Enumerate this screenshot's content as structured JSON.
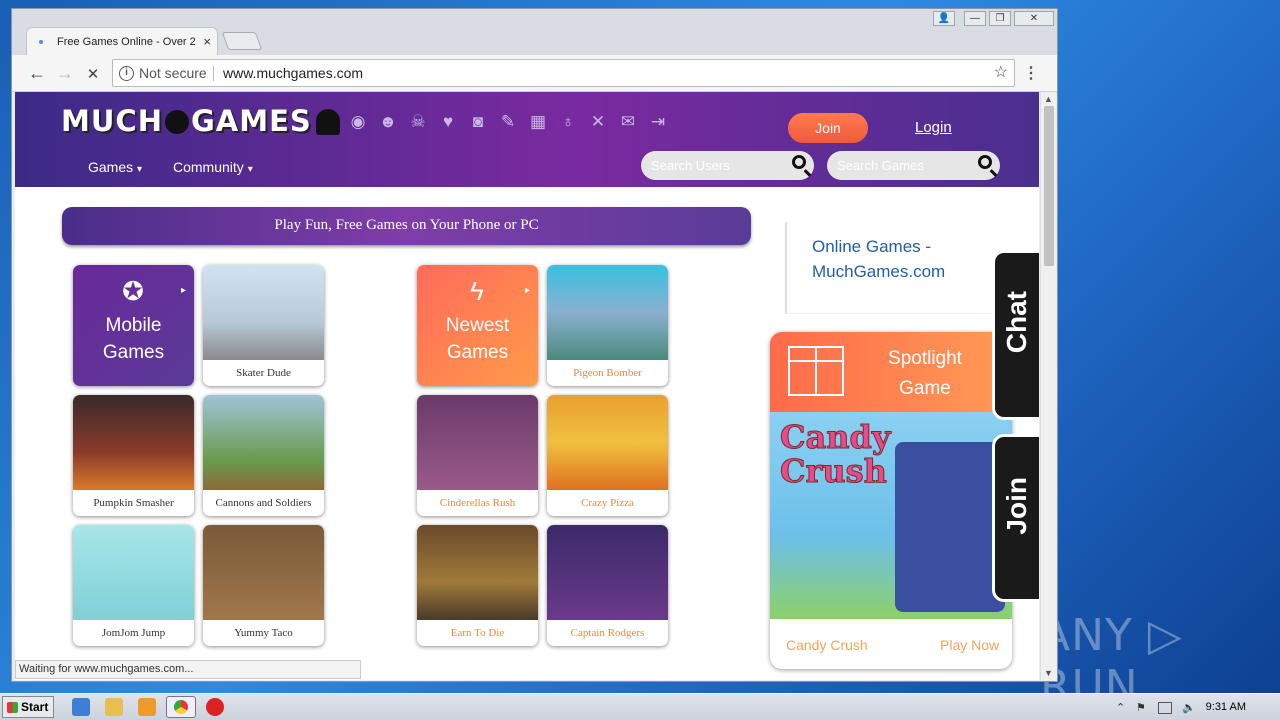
{
  "browser": {
    "tab_title": "Free Games Online - Over 2",
    "tab_close": "×",
    "not_secure": "Not secure",
    "url": "www.muchgames.com",
    "info": "i",
    "back": "←",
    "forward": "→",
    "stop": "✕",
    "star": "☆",
    "menu": "⋮",
    "window_controls": {
      "user": "👤",
      "minimize": "—",
      "restore": "❐",
      "close": "✕"
    }
  },
  "site": {
    "logo": {
      "part1": "MUCH",
      "part2": "GAMES"
    },
    "header_icons": [
      "rss-icon",
      "skull-icon",
      "skulls-icon",
      "heart-icon",
      "camera-icon",
      "pencil-icon",
      "gift-icon",
      "medal-icon",
      "tools-icon",
      "mail-icon",
      "logout-icon"
    ],
    "header_glyphs": [
      "◉",
      "☻",
      "☠",
      "♥",
      "◙",
      "✎",
      "▦",
      "♁",
      "✕",
      "✉",
      "⇥"
    ],
    "join": "Join",
    "login": "Login",
    "nav": {
      "games": "Games",
      "community": "Community",
      "caret": "▾"
    },
    "search_users": "Search Users",
    "search_games": "Search Games",
    "banner": "Play Fun, Free Games on Your Phone or PC",
    "categories": [
      {
        "label_line1": "Mobile",
        "label_line2": "Games",
        "icon": "star-icon",
        "glyph": "✪"
      },
      {
        "label_line1": "Newest",
        "label_line2": "Games",
        "icon": "bolt-icon",
        "glyph": "ϟ"
      }
    ],
    "arrow": "▸",
    "games_left": [
      "Skater Dude",
      "Pumpkin Smasher",
      "Cannons and Soldiers",
      "JomJom Jump",
      "Yummy Taco"
    ],
    "games_right": [
      "Pigeon Bomber",
      "Cinderellas Rush",
      "Crazy Pizza",
      "Earn To Die",
      "Captain Rodgers"
    ],
    "sidebar_link": "Online Games - MuchGames.com",
    "spotlight": {
      "title_line1": "Spotlight",
      "title_line2": "Game",
      "game": "Candy Crush",
      "play": "Play Now",
      "art_line1": "Candy",
      "art_line2": "Crush"
    },
    "chat_tab": "Chat",
    "join_tab": "Join"
  },
  "status": "Waiting for www.muchgames.com...",
  "watermark": "ANY ▷ RUN",
  "taskbar": {
    "start": "Start",
    "time": "9:31 AM",
    "flag": "⚑",
    "speaker": "🔈",
    "up": "⌃"
  },
  "colors": {
    "header_start": "#3c2a86",
    "header_end": "#7a2aa0",
    "accent_orange": "#f05a3a",
    "link_blue": "#1f5fa8"
  }
}
